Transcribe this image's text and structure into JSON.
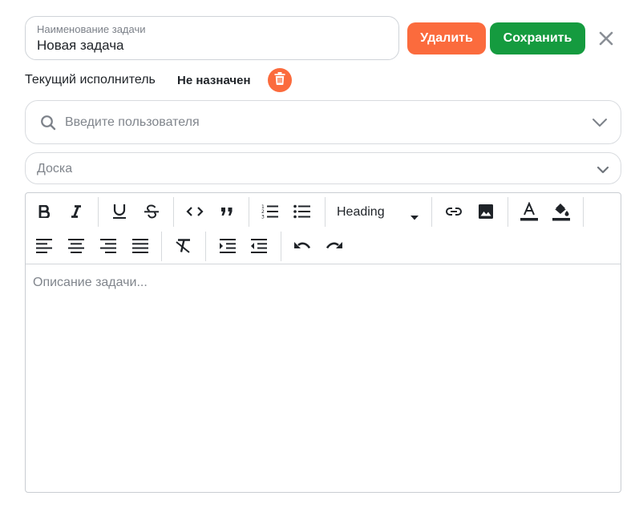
{
  "task": {
    "title_label": "Наименование задачи",
    "title_value": "Новая задача",
    "delete_label": "Удалить",
    "save_label": "Сохранить"
  },
  "assignee": {
    "label": "Текущий исполнитель",
    "value": "Не назначен"
  },
  "user_search": {
    "placeholder": "Введите пользователя"
  },
  "board": {
    "placeholder": "Доска"
  },
  "editor": {
    "heading_select": "Heading",
    "placeholder": "Описание задачи...",
    "toolbar_icons": [
      "bold-icon",
      "italic-icon",
      "underline-icon",
      "strikethrough-icon",
      "code-icon",
      "blockquote-icon",
      "ordered-list-icon",
      "bullet-list-icon",
      "link-icon",
      "image-icon",
      "text-color-icon",
      "highlight-color-icon",
      "align-left-icon",
      "align-center-icon",
      "align-right-icon",
      "align-justify-icon",
      "clear-format-icon",
      "indent-icon",
      "outdent-icon",
      "undo-icon",
      "redo-icon"
    ]
  },
  "colors": {
    "delete": "#fb6b3d",
    "save": "#159b3f",
    "trash": "#fb6b3d"
  }
}
